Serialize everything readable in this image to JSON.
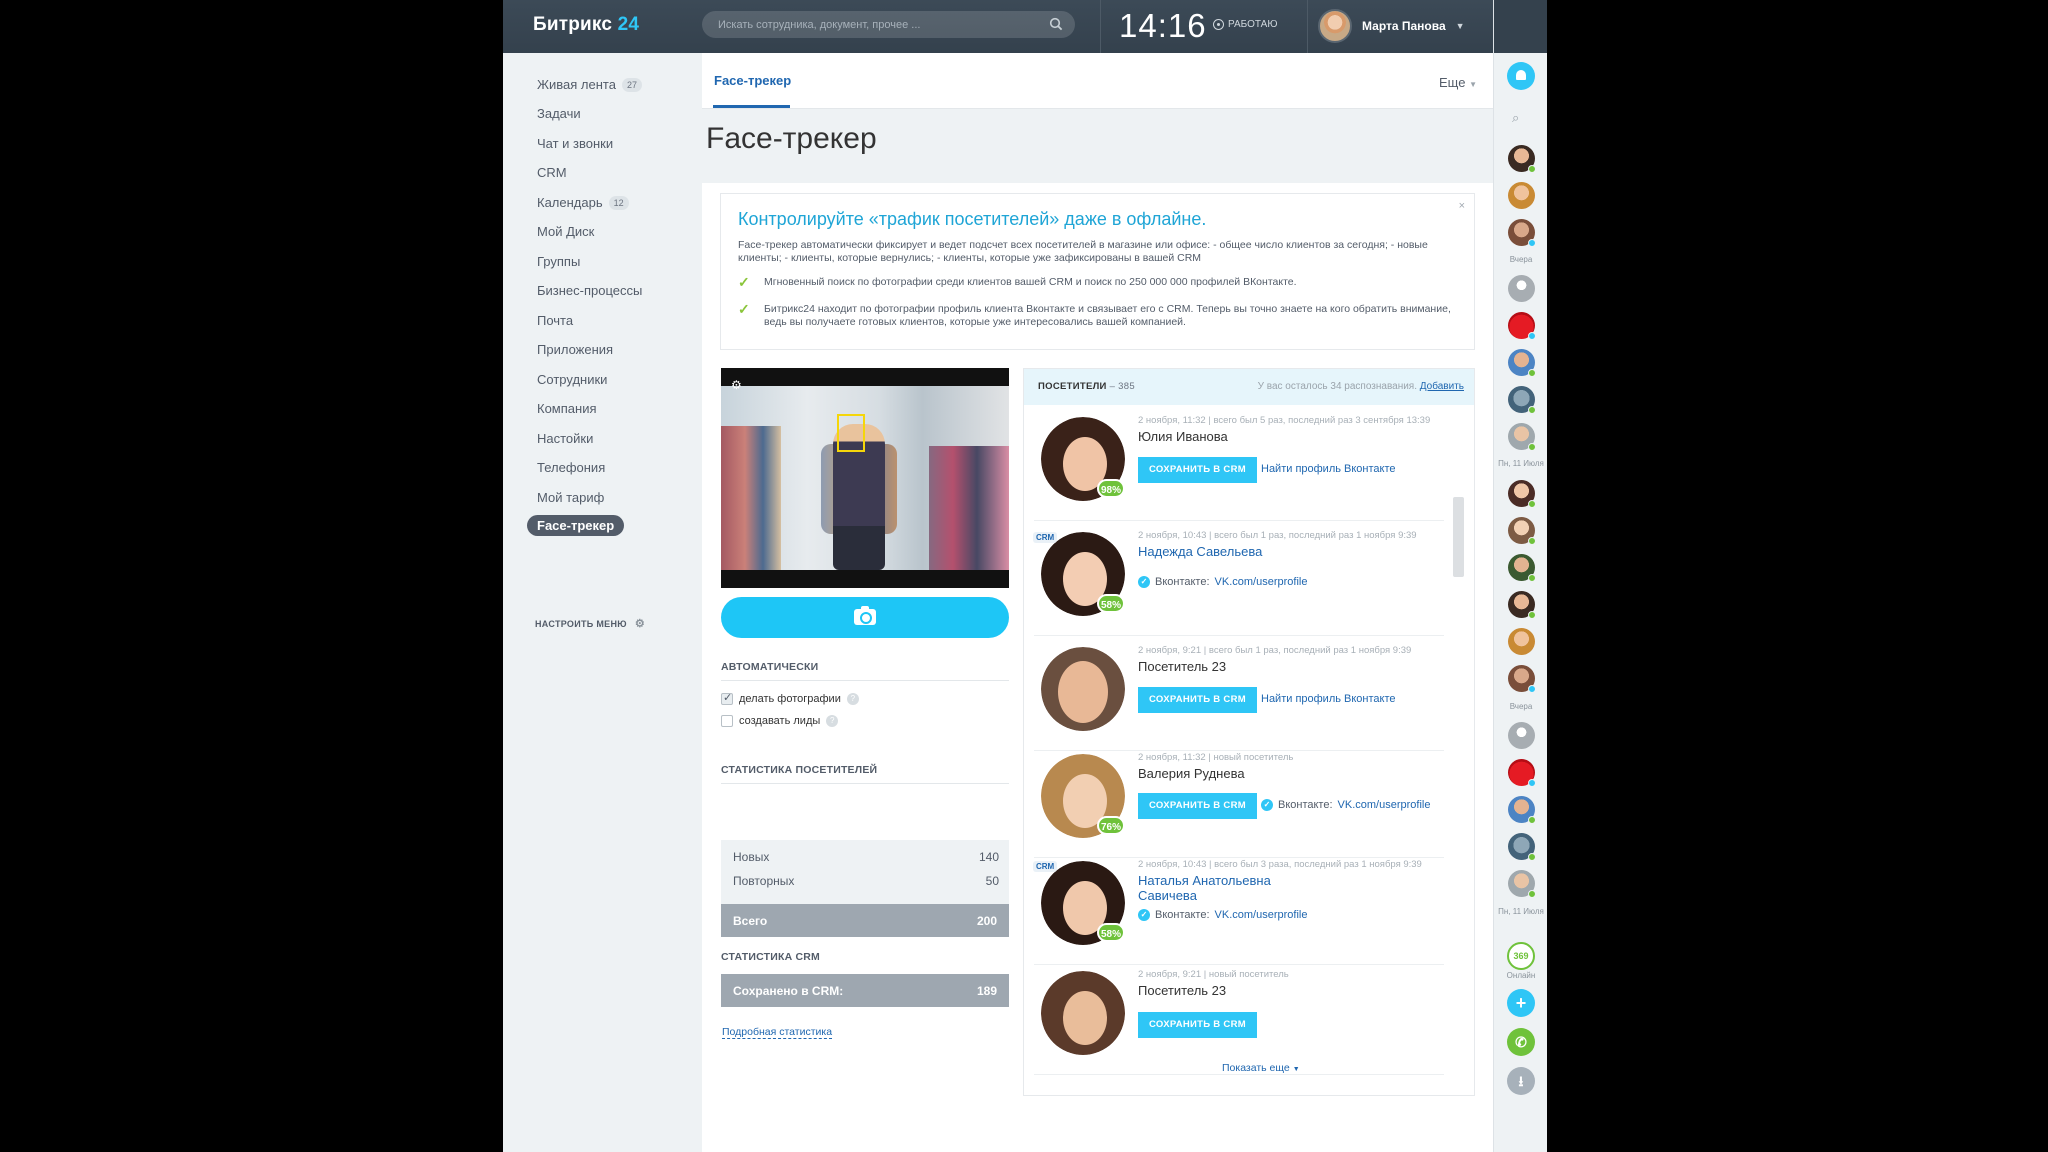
{
  "header": {
    "logo_text": "Битрикс",
    "logo_num": "24",
    "search_placeholder": "Искать сотрудника, документ, прочее ...",
    "time": "14:16",
    "work_status": "РАБОТАЮ",
    "user_name": "Марта Панова",
    "help": "?"
  },
  "menu": {
    "items": [
      {
        "label": "Живая лента",
        "badge": "27"
      },
      {
        "label": "Задачи"
      },
      {
        "label": "Чат и звонки"
      },
      {
        "label": "CRM"
      },
      {
        "label": "Календарь",
        "badge": "12"
      },
      {
        "label": "Мой Диск"
      },
      {
        "label": "Группы"
      },
      {
        "label": "Бизнес-процессы"
      },
      {
        "label": "Почта"
      },
      {
        "label": "Приложения"
      },
      {
        "label": "Сотрудники"
      },
      {
        "label": "Компания"
      },
      {
        "label": "Настойки"
      },
      {
        "label": "Телефония"
      },
      {
        "label": "Мой тариф"
      },
      {
        "label": "Face-трекер"
      }
    ],
    "configure": "НАСТРОИТЬ МЕНЮ"
  },
  "tabs": {
    "active": "Face-трекер",
    "more": "Еще"
  },
  "page_title": "Face-трекер",
  "promo": {
    "title": "Контролируйте «трафик посетителей» даже в офлайне.",
    "close": "×",
    "text": "Face-трекер автоматически фиксирует и ведет подсчет всех посетителей в магазине или офисе: - общее число клиентов за сегодня; - новые клиенты; - клиенты, которые вернулись; - клиенты, которые уже зафиксированы в вашей CRM",
    "point1": "Мгновенный поиск по фотографии среди клиентов вашей CRM и поиск по 250 000 000 профилей ВКонтакте.",
    "point2": "Битрикс24 находит по фотографии профиль клиента Вконтакте и связывает его с CRM. Теперь вы точно знаете на кого обратить внимание, ведь вы получаете готовых клиентов, которые уже интересовались вашей компанией."
  },
  "auto": {
    "title": "АВТОМАТИЧЕСКИ",
    "opt1": "делать фотографии",
    "opt1_checked": true,
    "opt2": "создавать лиды",
    "opt2_checked": false
  },
  "stats": {
    "title": "СТАТИСТИКА ПОСЕТИТЕЛЕЙ",
    "new_label": "Новых",
    "new_value": "140",
    "repeat_label": "Повторных",
    "repeat_value": "50",
    "total_label": "Всего",
    "total_value": "200",
    "crm_title": "СТАТИСТИКА CRM",
    "crm_label": "Сохранено в CRM:",
    "crm_value": "189",
    "link": "Подробная статистика"
  },
  "visitors": {
    "header_label": "ПОСЕТИТЕЛИ",
    "header_count": " – 385",
    "remaining": "У вас осталось 34 распознавания.",
    "add": "Добавить",
    "save_label": "СОХРАНИТЬ В CRM",
    "find_vk": "Найти профиль Вконтакте",
    "vk_prefix": "Вконтакте:",
    "vk_link": "VK.com/userprofile",
    "show_more": "Показать еще",
    "list": [
      {
        "meta": "2 ноября, 11:32  |  всего был 5 раз, последний раз 3 сентября 13:39",
        "name": "Юлия Иванова",
        "pct": "98%"
      },
      {
        "meta": "2 ноября, 10:43  |  всего был 1 раз, последний раз 1 ноября 9:39",
        "name": "Надежда Савельева",
        "pct": "58%",
        "crm": "CRM"
      },
      {
        "meta": "2 ноября, 9:21  |  всего был 1 раз, последний раз 1 ноября 9:39",
        "name": "Посетитель 23"
      },
      {
        "meta": "2 ноября, 11:32 | новый посетитель",
        "name": "Валерия Руднева",
        "pct": "76%"
      },
      {
        "meta": "2 ноября, 10:43  |  всего был 3 раза, последний раз 1 ноября 9:39",
        "name_line1": "Наталья Анатольевна",
        "name_line2": "Савичева",
        "pct": "58%",
        "crm": "CRM"
      },
      {
        "meta": "2 ноября, 9:21 | новый посетитель",
        "name": "Посетитель 23"
      }
    ]
  },
  "rightbar": {
    "yesterday1": "Вчера",
    "date1": "Пн, 11 Июля",
    "yesterday2": "Вчера",
    "date2": "Пн, 11 Июля",
    "online_count": "369",
    "online_label": "Онлайн"
  },
  "colors": {
    "accent": "#2fc6f6",
    "link": "#2067b0",
    "header": "#34414d",
    "online": "#6fc23b"
  }
}
